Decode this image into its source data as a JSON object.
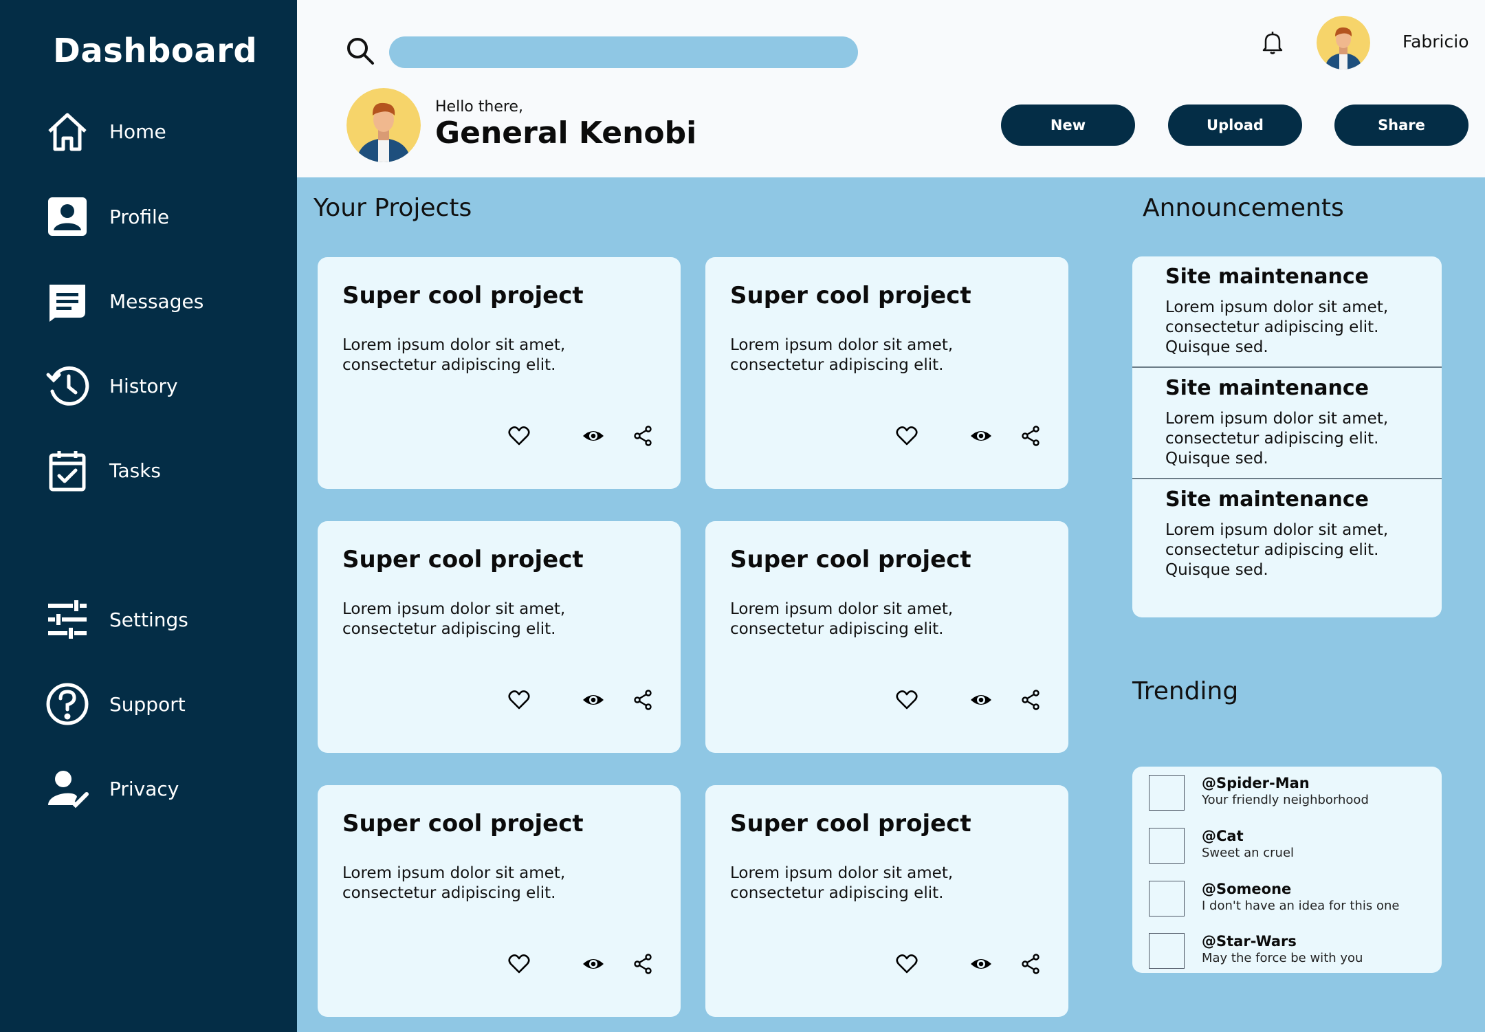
{
  "brand": "Dashboard",
  "sidebar": {
    "items": [
      {
        "label": "Home",
        "icon": "home-icon"
      },
      {
        "label": "Profile",
        "icon": "profile-icon"
      },
      {
        "label": "Messages",
        "icon": "messages-icon"
      },
      {
        "label": "History",
        "icon": "history-icon"
      },
      {
        "label": "Tasks",
        "icon": "tasks-icon"
      },
      {
        "label": "Settings",
        "icon": "settings-icon"
      },
      {
        "label": "Support",
        "icon": "support-icon"
      },
      {
        "label": "Privacy",
        "icon": "privacy-icon"
      }
    ]
  },
  "header": {
    "search_placeholder": "",
    "username": "Fabricio",
    "greeting": "Hello there,",
    "name": "General Kenobi",
    "buttons": {
      "new": "New",
      "upload": "Upload",
      "share": "Share"
    }
  },
  "projects": {
    "title": "Your Projects",
    "cards": [
      {
        "title": "Super cool project",
        "description": "Lorem ipsum dolor sit amet, consectetur adipiscing elit."
      },
      {
        "title": "Super cool project",
        "description": "Lorem ipsum dolor sit amet, consectetur adipiscing elit."
      },
      {
        "title": "Super cool project",
        "description": "Lorem ipsum dolor sit amet, consectetur adipiscing elit."
      },
      {
        "title": "Super cool project",
        "description": "Lorem ipsum dolor sit amet, consectetur adipiscing elit."
      },
      {
        "title": "Super cool project",
        "description": "Lorem ipsum dolor sit amet, consectetur adipiscing elit."
      },
      {
        "title": "Super cool project",
        "description": "Lorem ipsum dolor sit amet, consectetur adipiscing elit."
      }
    ]
  },
  "announcements": {
    "title": "Announcements",
    "items": [
      {
        "title": "Site maintenance",
        "body": "Lorem ipsum dolor sit amet, consectetur adipiscing elit. Quisque sed."
      },
      {
        "title": "Site maintenance",
        "body": "Lorem ipsum dolor sit amet, consectetur adipiscing elit. Quisque sed."
      },
      {
        "title": "Site maintenance",
        "body": "Lorem ipsum dolor sit amet, consectetur adipiscing elit. Quisque sed."
      }
    ]
  },
  "trending": {
    "title": "Trending",
    "items": [
      {
        "handle": "@Spider-Man",
        "text": "Your friendly neighborhood"
      },
      {
        "handle": "@Cat",
        "text": "Sweet an cruel"
      },
      {
        "handle": "@Someone",
        "text": "I don't have an idea for this one"
      },
      {
        "handle": "@Star-Wars",
        "text": "May the force be with you"
      }
    ]
  },
  "colors": {
    "sidebar": "#042d46",
    "accent": "#8fc7e4",
    "card": "#eaf8fd",
    "topbar": "#f8fafc"
  }
}
